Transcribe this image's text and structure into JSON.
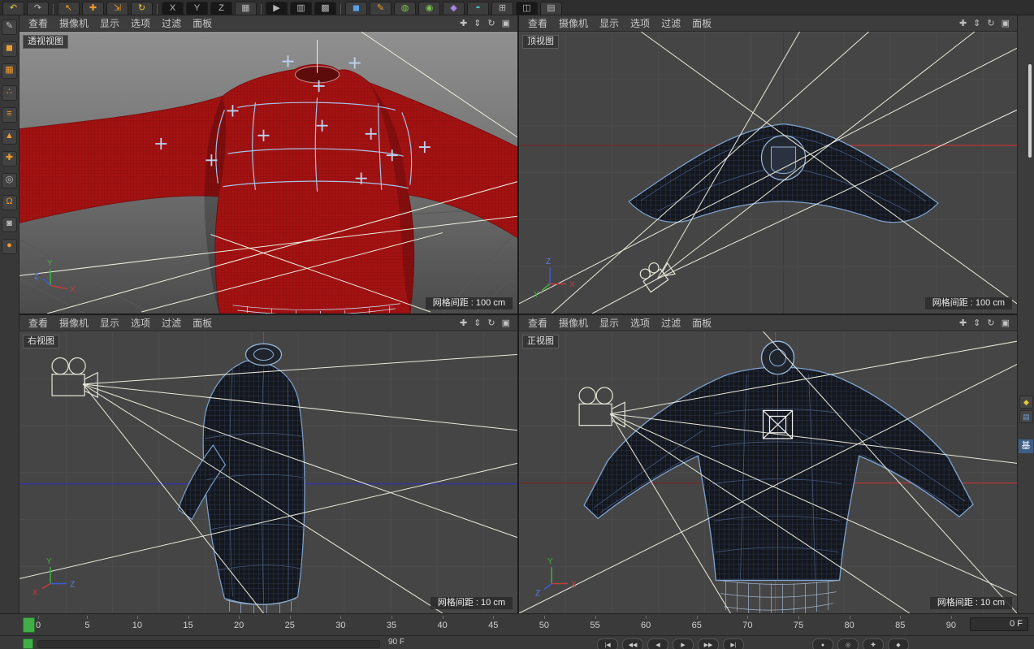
{
  "axes": {
    "x": "X",
    "y": "Y",
    "z": "Z"
  },
  "colors": {
    "mesh_red": "#a31212",
    "wire_blue": "#7fa3cf",
    "axis_green": "#3fae3f",
    "axis_red": "#c23b3b",
    "axis_blue": "#3a5bd9",
    "marker_green": "#41ae47",
    "ui_background": "#3a3a3a",
    "accent_orange": "#f09a2e"
  },
  "toolbar": {
    "icons": [
      {
        "name": "undo",
        "glyph": "↶"
      },
      {
        "name": "redo",
        "glyph": "↷"
      },
      {
        "name": "live-selection",
        "glyph": "↖"
      },
      {
        "name": "move-tool",
        "glyph": "✚"
      },
      {
        "name": "scale-tool",
        "glyph": "⇲"
      },
      {
        "name": "rotate-tool",
        "glyph": "↻"
      },
      {
        "name": "x-axis-lock",
        "glyph": "X"
      },
      {
        "name": "y-axis-lock",
        "glyph": "Y"
      },
      {
        "name": "z-axis-lock",
        "glyph": "Z"
      },
      {
        "name": "coordinate-system",
        "glyph": "▦"
      },
      {
        "name": "render-view",
        "glyph": "▶"
      },
      {
        "name": "render-picture-viewer",
        "glyph": "▥"
      },
      {
        "name": "render-settings",
        "glyph": "▩"
      },
      {
        "name": "primitive-cube",
        "glyph": "◼"
      },
      {
        "name": "spline-pen",
        "glyph": "✎"
      },
      {
        "name": "generators",
        "glyph": "◍"
      },
      {
        "name": "modeling-tools",
        "glyph": "◉"
      },
      {
        "name": "deformers",
        "glyph": "◆"
      },
      {
        "name": "environment-objects",
        "glyph": "◓"
      },
      {
        "name": "mograph",
        "glyph": "⊞"
      },
      {
        "name": "camera-objects",
        "glyph": "◫"
      },
      {
        "name": "display-settings",
        "glyph": "▤"
      }
    ]
  },
  "sidebar": {
    "icons": [
      {
        "name": "make-editable",
        "glyph": "✎"
      },
      {
        "name": "model-mode",
        "glyph": "◼"
      },
      {
        "name": "texture-mode",
        "glyph": "▦"
      },
      {
        "name": "points-mode",
        "glyph": "∴"
      },
      {
        "name": "edges-mode",
        "glyph": "≡"
      },
      {
        "name": "polygons-mode",
        "glyph": "▲"
      },
      {
        "name": "enable-axis",
        "glyph": "✚"
      },
      {
        "name": "viewport-solo",
        "glyph": "◎"
      },
      {
        "name": "snap",
        "glyph": "Ω"
      },
      {
        "name": "lock-workplane",
        "glyph": "◙"
      },
      {
        "name": "quantize",
        "glyph": "●"
      }
    ]
  },
  "viewport_nav": {
    "pan": "✚",
    "zoom": "⇕",
    "rotate": "↻",
    "toggle": "▣"
  },
  "viewports": [
    {
      "label": "透视视图",
      "grid_label": "网格间距 : 100 cm",
      "menu": [
        "查看",
        "摄像机",
        "显示",
        "选项",
        "过滤",
        "面板"
      ]
    },
    {
      "label": "顶视图",
      "grid_label": "网格间距 : 100 cm",
      "menu": [
        "查看",
        "摄像机",
        "显示",
        "选项",
        "过滤",
        "面板"
      ]
    },
    {
      "label": "右视图",
      "grid_label": "网格间距 : 10 cm",
      "menu": [
        "查看",
        "摄像机",
        "显示",
        "选项",
        "过滤",
        "面板"
      ]
    },
    {
      "label": "正视图",
      "grid_label": "网格间距 : 10 cm",
      "menu": [
        "查看",
        "摄像机",
        "显示",
        "选项",
        "过滤",
        "面板"
      ]
    }
  ],
  "timeline": {
    "ticks": [
      "0",
      "5",
      "10",
      "15",
      "20",
      "25",
      "30",
      "35",
      "40",
      "45",
      "50",
      "55",
      "60",
      "65",
      "70",
      "75",
      "80",
      "85",
      "90"
    ],
    "frame_field": "0 F"
  },
  "bottom_bar": {
    "range_end": "90 F",
    "playback": [
      {
        "name": "goto-start",
        "glyph": "|◀"
      },
      {
        "name": "prev-key",
        "glyph": "◀◀"
      },
      {
        "name": "prev-frame",
        "glyph": "◀"
      },
      {
        "name": "play",
        "glyph": "▶"
      },
      {
        "name": "next-frame",
        "glyph": "▶▶"
      },
      {
        "name": "goto-end",
        "glyph": "▶|"
      }
    ],
    "record": [
      {
        "name": "record-keyframe",
        "glyph": "●"
      },
      {
        "name": "autokey",
        "glyph": "◎"
      },
      {
        "name": "record-position",
        "glyph": "✚"
      },
      {
        "name": "record-scale",
        "glyph": "◆"
      }
    ]
  },
  "right_strip": {
    "tab_label": "基"
  }
}
